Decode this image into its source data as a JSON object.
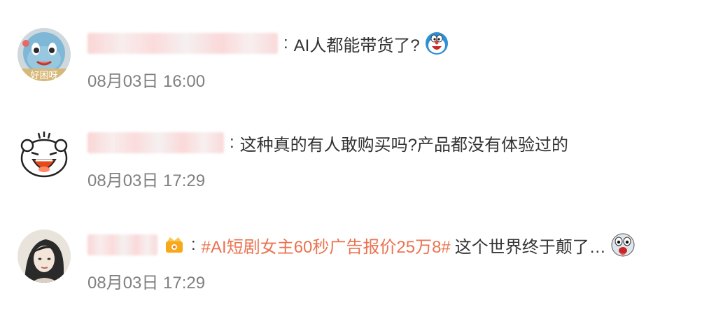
{
  "comments": [
    {
      "avatar_icon": "cartoon-squirtle-avatar-icon",
      "text": "AI人都能带货了?",
      "emoji_icon": "doraemon-emoji-icon",
      "timestamp": "08月03日 16:00"
    },
    {
      "avatar_icon": "cartoon-bear-laughing-avatar-icon",
      "text": "这种真的有人敢购买吗?产品都没有体验过的",
      "timestamp": "08月03日 17:29"
    },
    {
      "avatar_icon": "woman-portrait-avatar-icon",
      "badge_icon": "vip-badge-icon",
      "hashtag": "#AI短剧女主60秒广告报价25万8#",
      "text": "这个世界终于颠了…",
      "emoji_icon": "shocked-face-emoji-icon",
      "timestamp": "08月03日 17:29"
    }
  ],
  "colon": ":",
  "colors": {
    "hashtag": "#eb7350",
    "text": "#333333",
    "timestamp": "#808080"
  }
}
